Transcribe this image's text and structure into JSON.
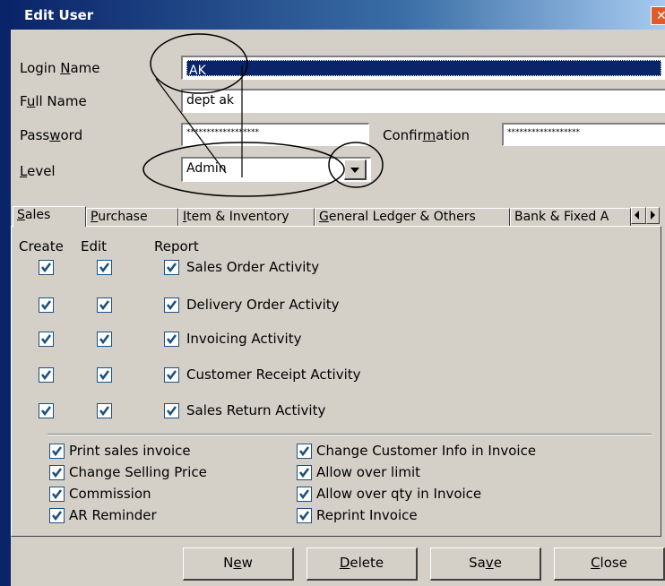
{
  "window": {
    "title": "Edit User"
  },
  "form": {
    "login_name_label": "Login Name",
    "login_name_value": "AK",
    "full_name_label": "Full Name",
    "full_name_value": "dept ak",
    "password_label": "Password",
    "password_value": "******************",
    "confirmation_label": "Confirmation",
    "confirmation_value": "******************",
    "level_label": "Level",
    "level_value": "Admin"
  },
  "tabs": [
    "Sales",
    "Purchase",
    "Item & Inventory",
    "General Ledger & Others",
    "Bank & Fixed A"
  ],
  "columns": {
    "create": "Create",
    "edit": "Edit",
    "report": "Report"
  },
  "permissions": [
    {
      "label": "Sales Order Activity",
      "create": true,
      "edit": true,
      "report": true
    },
    {
      "label": "Delivery Order Activity",
      "create": true,
      "edit": true,
      "report": true
    },
    {
      "label": "Invoicing Activity",
      "create": true,
      "edit": true,
      "report": true
    },
    {
      "label": "Customer Receipt Activity",
      "create": true,
      "edit": true,
      "report": true
    },
    {
      "label": "Sales Return Activity",
      "create": true,
      "edit": true,
      "report": true
    }
  ],
  "options_left": [
    {
      "label": "Print sales invoice",
      "checked": true
    },
    {
      "label": "Change Selling Price",
      "checked": true
    },
    {
      "label": "Commission",
      "checked": true
    },
    {
      "label": "AR Reminder",
      "checked": true
    }
  ],
  "options_right": [
    {
      "label": "Change Customer Info in Invoice",
      "checked": true
    },
    {
      "label": "Allow over limit",
      "checked": true
    },
    {
      "label": "Allow over qty in Invoice",
      "checked": true
    },
    {
      "label": "Reprint Invoice",
      "checked": true
    }
  ],
  "buttons": {
    "new": "New",
    "delete": "Delete",
    "save": "Save",
    "close": "Close"
  },
  "colors": {
    "selection": "#0a246a",
    "face": "#d4d0c8",
    "check": "#1c5180",
    "annotation": "#000000"
  }
}
